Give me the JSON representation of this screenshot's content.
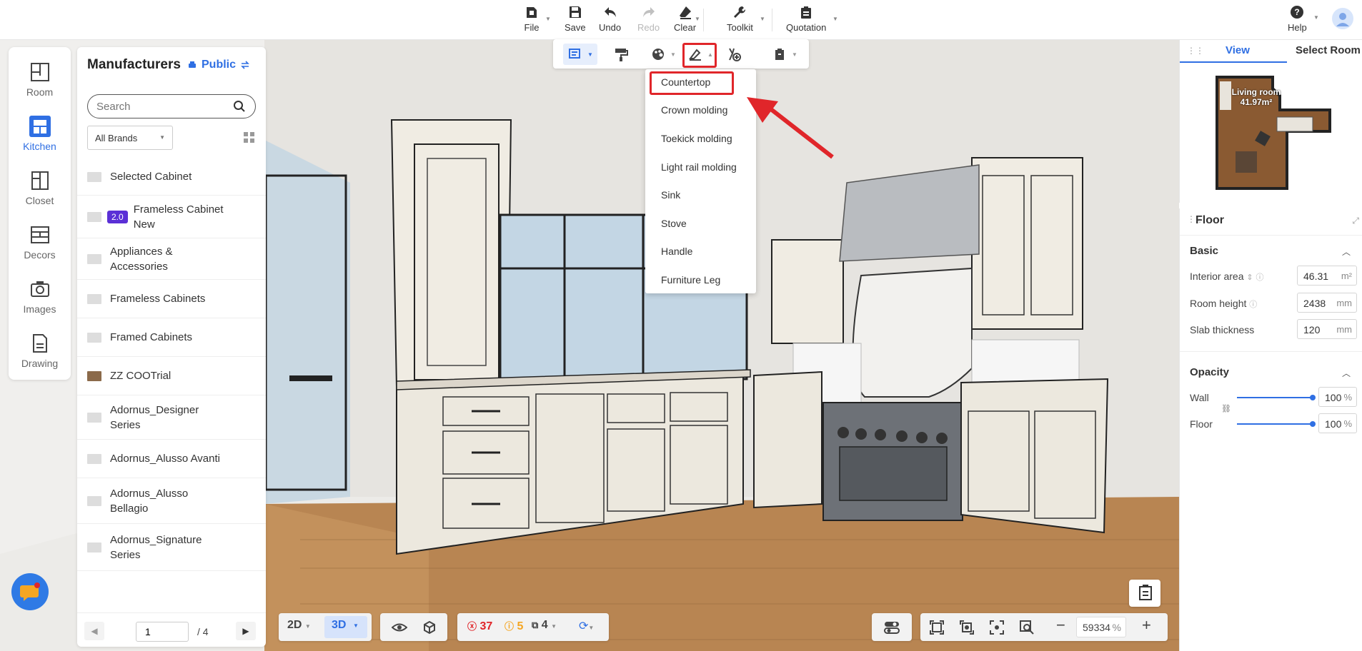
{
  "toolbar": {
    "file": "File",
    "save": "Save",
    "undo": "Undo",
    "redo": "Redo",
    "clear": "Clear",
    "toolkit": "Toolkit",
    "quotation": "Quotation",
    "help": "Help"
  },
  "left_rail": {
    "items": [
      {
        "label": "Room",
        "icon": "room-icon"
      },
      {
        "label": "Kitchen",
        "icon": "kitchen-icon",
        "active": true
      },
      {
        "label": "Closet",
        "icon": "closet-icon"
      },
      {
        "label": "Decors",
        "icon": "decors-icon"
      },
      {
        "label": "Images",
        "icon": "camera-icon"
      },
      {
        "label": "Drawing",
        "icon": "drawing-icon"
      }
    ]
  },
  "manufacturers": {
    "title": "Manufacturers",
    "scope": "Public",
    "search_placeholder": "Search",
    "brand_filter": "All Brands",
    "items": [
      {
        "label": "Selected Cabinet"
      },
      {
        "label": "Frameless Cabinet New",
        "badge": "2.0"
      },
      {
        "label": "Appliances & Accessories"
      },
      {
        "label": "Frameless Cabinets"
      },
      {
        "label": "Framed Cabinets"
      },
      {
        "label": "ZZ COOTrial"
      },
      {
        "label": "Adornus_Designer Series"
      },
      {
        "label": "Adornus_Alusso Avanti"
      },
      {
        "label": "Adornus_Alusso Bellagio"
      },
      {
        "label": "Adornus_Signature Series"
      }
    ],
    "pager": {
      "current": "1",
      "total": "/ 4"
    }
  },
  "dropdown": {
    "items": [
      "Countertop",
      "Crown molding",
      "Toekick molding",
      "Light rail molding",
      "Sink",
      "Stove",
      "Handle",
      "Furniture Leg"
    ]
  },
  "view_panel": {
    "tabs": [
      "View",
      "Select Room"
    ],
    "minimap_label": "Living room",
    "minimap_area": "41.97m²"
  },
  "properties": {
    "title": "Floor",
    "basic_title": "Basic",
    "interior_area": {
      "label": "Interior area",
      "value": "46.31",
      "unit": "m²"
    },
    "room_height": {
      "label": "Room height",
      "value": "2438",
      "unit": "mm"
    },
    "slab_thickness": {
      "label": "Slab thickness",
      "value": "120",
      "unit": "mm"
    },
    "opacity_title": "Opacity",
    "wall": {
      "label": "Wall",
      "value": "100",
      "unit": "%"
    },
    "floor": {
      "label": "Floor",
      "value": "100",
      "unit": "%"
    }
  },
  "bottom": {
    "view_2d": "2D",
    "view_3d": "3D",
    "errors": "37",
    "warnings": "5",
    "items": "4",
    "zoom": "59334",
    "zoom_unit": "%"
  },
  "colors": {
    "accent": "#2f6fe3",
    "highlight": "#e0262a",
    "badge": "#5b30d6"
  }
}
